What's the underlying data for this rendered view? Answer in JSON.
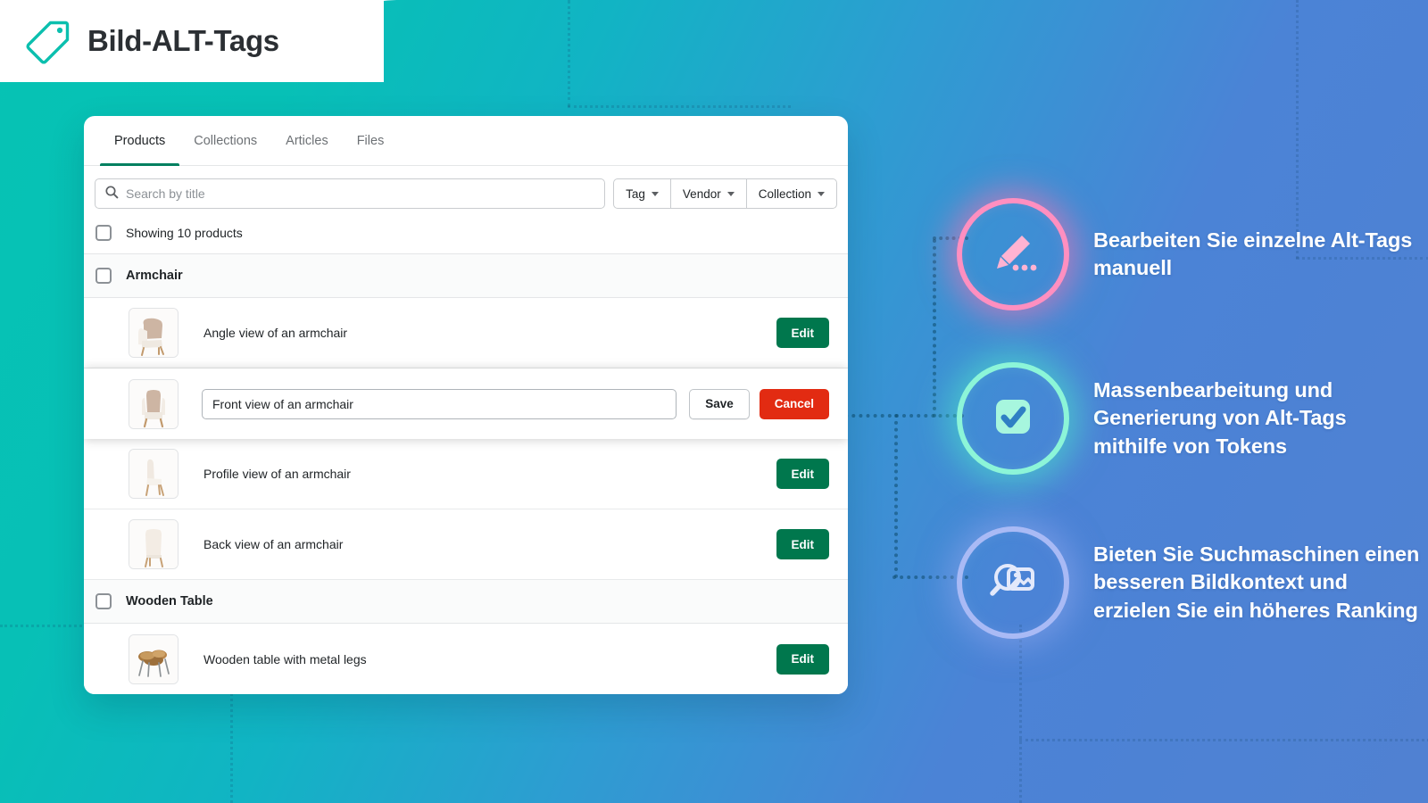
{
  "header": {
    "title": "Bild-ALT-Tags",
    "icon": "tag-icon"
  },
  "panel": {
    "tabs": [
      {
        "label": "Products",
        "active": true
      },
      {
        "label": "Collections",
        "active": false
      },
      {
        "label": "Articles",
        "active": false
      },
      {
        "label": "Files",
        "active": false
      }
    ],
    "search": {
      "placeholder": "Search by title",
      "value": "",
      "icon": "search-icon"
    },
    "filters": [
      {
        "label": "Tag",
        "icon": "chevron-down-icon"
      },
      {
        "label": "Vendor",
        "icon": "chevron-down-icon"
      },
      {
        "label": "Collection",
        "icon": "chevron-down-icon"
      }
    ],
    "summary": {
      "text": "Showing 10 products",
      "checked": false
    },
    "groups": [
      {
        "title": "Armchair",
        "checked": false,
        "images": [
          {
            "alt": "Angle view of an armchair",
            "thumb": "armchair-angle-thumb",
            "mode": "view",
            "action_label": "Edit"
          },
          {
            "alt": "Front view of an armchair",
            "thumb": "armchair-front-thumb",
            "mode": "edit",
            "save_label": "Save",
            "cancel_label": "Cancel"
          },
          {
            "alt": "Profile view of an armchair",
            "thumb": "armchair-profile-thumb",
            "mode": "view",
            "action_label": "Edit"
          },
          {
            "alt": "Back view of an armchair",
            "thumb": "armchair-back-thumb",
            "mode": "view",
            "action_label": "Edit"
          }
        ]
      },
      {
        "title": "Wooden Table",
        "checked": false,
        "images": [
          {
            "alt": "Wooden table with metal legs",
            "thumb": "wooden-table-thumb",
            "mode": "view",
            "action_label": "Edit"
          }
        ]
      }
    ]
  },
  "features": [
    {
      "text": "Bearbeiten Sie einzelne Alt-Tags manuell",
      "icon": "pencil-edit-icon",
      "color": "#ff8fc0",
      "glow": "#ff73b3"
    },
    {
      "text": "Massenbearbeitung und Generierung von Alt-Tags mithilfe von Tokens",
      "icon": "checkbox-checked-icon",
      "color": "#8cf5d8",
      "glow": "#4fecc8"
    },
    {
      "text": "Bieten Sie Suchmaschinen einen besseren Bildkontext und erzielen Sie ein höheres Ranking",
      "icon": "image-search-icon",
      "color": "#a9baf5",
      "glow": "#93a9f0"
    }
  ],
  "colors": {
    "brand_teal": "#06c3b4",
    "brand_blue": "#5081d2",
    "accent_green": "#00774d",
    "accent_red": "#e22b12",
    "tab_underline": "#008060"
  }
}
